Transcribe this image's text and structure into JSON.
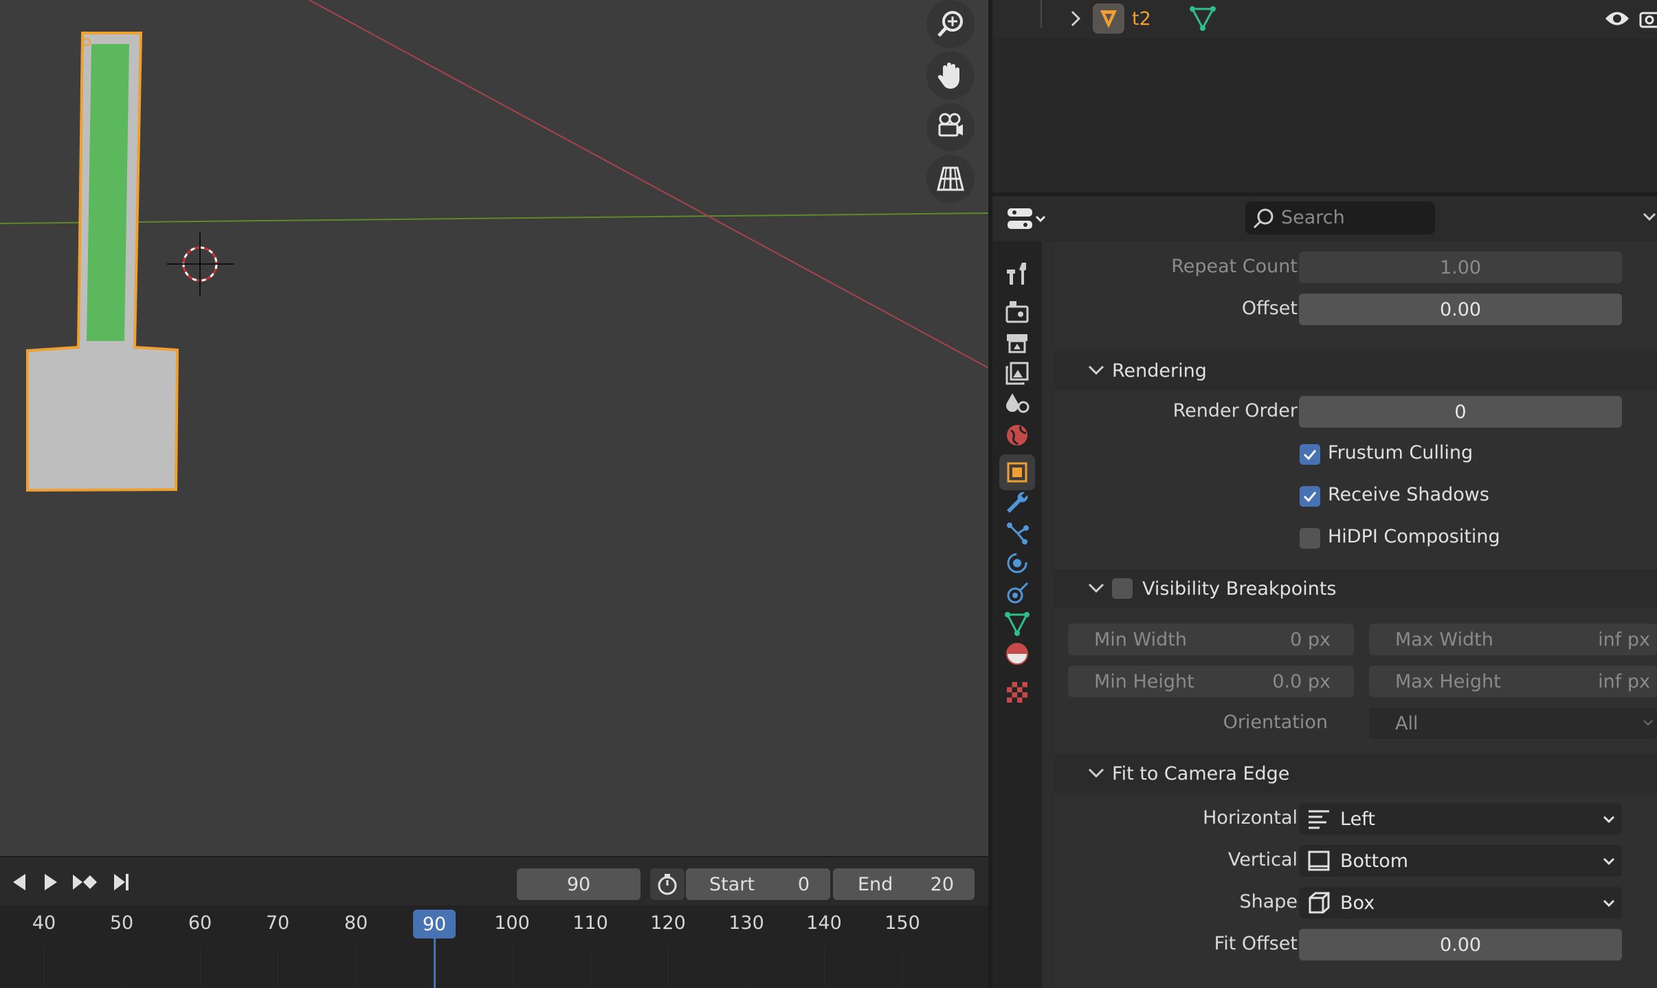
{
  "outliner": {
    "object_name": "t2"
  },
  "timeline": {
    "current_frame": "90",
    "start_label": "Start",
    "start_value": "0",
    "end_label": "End",
    "end_value": "20",
    "ruler": [
      "40",
      "50",
      "60",
      "70",
      "80",
      "90",
      "100",
      "110",
      "120",
      "130",
      "140",
      "150"
    ]
  },
  "properties": {
    "search_placeholder": "Search",
    "repeat_count_label": "Repeat Count",
    "repeat_count_value": "1.00",
    "offset_label": "Offset",
    "offset_value": "0.00",
    "rendering_title": "Rendering",
    "render_order_label": "Render Order",
    "render_order_value": "0",
    "frustum_culling": "Frustum Culling",
    "receive_shadows": "Receive Shadows",
    "hidpi": "HiDPI Compositing",
    "visibility_title": "Visibility Breakpoints",
    "min_width_label": "Min Width",
    "min_width_value": "0 px",
    "max_width_label": "Max Width",
    "max_width_value": "inf px",
    "min_height_label": "Min Height",
    "min_height_value": "0.0 px",
    "max_height_label": "Max Height",
    "max_height_value": "inf px",
    "orientation_label": "Orientation",
    "orientation_value": "All",
    "fit_title": "Fit to Camera Edge",
    "horizontal_label": "Horizontal",
    "horizontal_value": "Left",
    "vertical_label": "Vertical",
    "vertical_value": "Bottom",
    "shape_label": "Shape",
    "shape_value": "Box",
    "fit_offset_label": "Fit Offset",
    "fit_offset_value": "0.00"
  },
  "colors": {
    "accent": "#4772b3",
    "selected_outline": "#f0a030",
    "object_green": "#5cb85c",
    "object_grey": "#bfbebe"
  }
}
